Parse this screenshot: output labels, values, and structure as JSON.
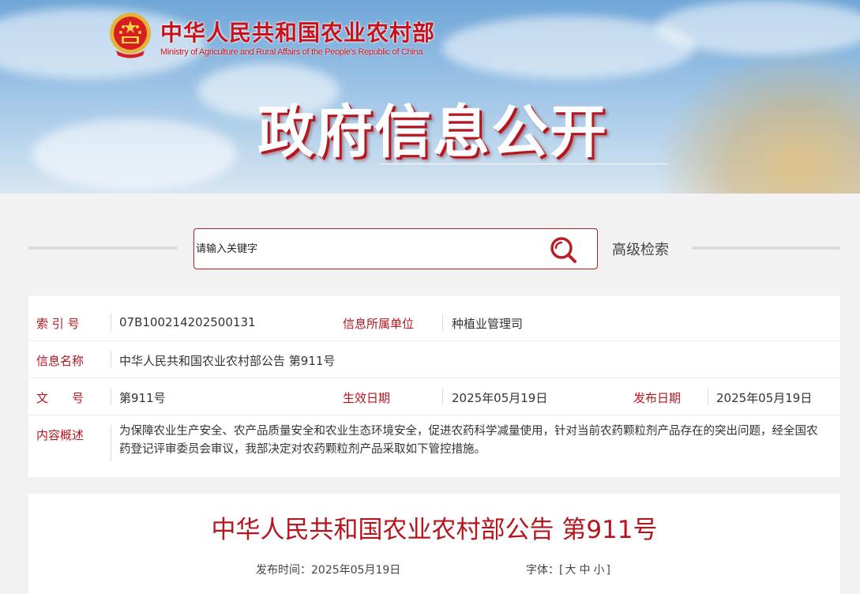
{
  "header": {
    "ministry_name_cn": "中华人民共和国农业农村部",
    "ministry_name_en": "Ministry of Agriculture and Rural Affairs of the People's Republic of China",
    "banner_title": "政府信息公开",
    "emblem_icon": "national-emblem-icon"
  },
  "search": {
    "placeholder": "请输入关键字",
    "search_icon": "search-icon",
    "advanced_label": "高级检索"
  },
  "info": {
    "index_no_label": "索 引 号",
    "index_no": "07B100214202500131",
    "unit_label": "信息所属单位",
    "unit": "种植业管理司",
    "name_label": "信息名称",
    "name": "中华人民共和国农业农村部公告 第911号",
    "doc_no_label": "文　　号",
    "doc_no": "第911号",
    "effective_label": "生效日期",
    "effective_date": "2025年05月19日",
    "publish_label": "发布日期",
    "publish_date": "2025年05月19日",
    "summary_label": "内容概述",
    "summary": "为保障农业生产安全、农产品质量安全和农业生态环境安全，促进农药科学减量使用，针对当前农药颗粒剂产品存在的突出问题，经全国农药登记评审委员会审议，我部决定对农药颗粒剂产品采取如下管控措施。"
  },
  "article": {
    "title": "中华人民共和国农业农村部公告 第911号",
    "pub_time_label": "发布时间：",
    "pub_time": "2025年05月19日",
    "font_size_label": "字体：",
    "font_size_open": "[",
    "font_large": "大",
    "font_medium": "中",
    "font_small": "小",
    "font_size_close": "]"
  },
  "colors": {
    "accent_red": "#b5161e",
    "ministry_red": "#c8121b"
  }
}
